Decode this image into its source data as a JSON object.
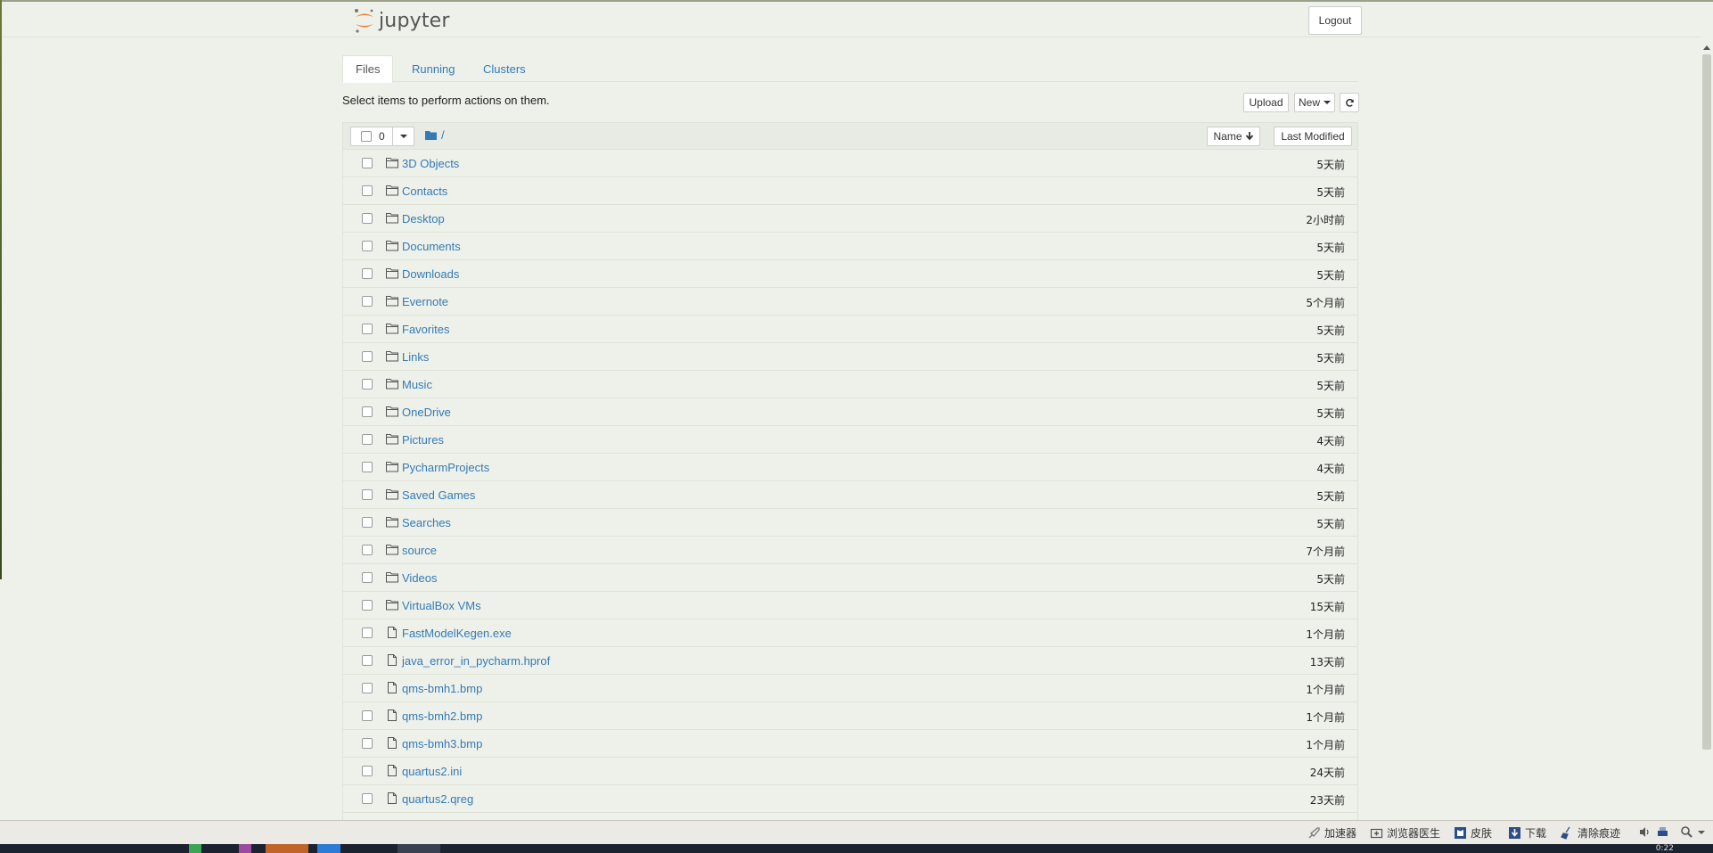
{
  "header": {
    "logo_text": "jupyter",
    "logout_label": "Logout"
  },
  "tabs": [
    {
      "label": "Files",
      "active": true
    },
    {
      "label": "Running",
      "active": false
    },
    {
      "label": "Clusters",
      "active": false
    }
  ],
  "toolbar": {
    "instructions": "Select items to perform actions on them.",
    "upload_label": "Upload",
    "new_label": "New",
    "refresh_icon": "refresh-icon"
  },
  "list_header": {
    "selected_count": "0",
    "breadcrumb": "/",
    "sort_name_label": "Name",
    "sort_modified_label": "Last Modified"
  },
  "items": [
    {
      "name": "3D Objects",
      "type": "folder",
      "modified": "5天前"
    },
    {
      "name": "Contacts",
      "type": "folder",
      "modified": "5天前"
    },
    {
      "name": "Desktop",
      "type": "folder",
      "modified": "2小时前"
    },
    {
      "name": "Documents",
      "type": "folder",
      "modified": "5天前"
    },
    {
      "name": "Downloads",
      "type": "folder",
      "modified": "5天前"
    },
    {
      "name": "Evernote",
      "type": "folder",
      "modified": "5个月前"
    },
    {
      "name": "Favorites",
      "type": "folder",
      "modified": "5天前"
    },
    {
      "name": "Links",
      "type": "folder",
      "modified": "5天前"
    },
    {
      "name": "Music",
      "type": "folder",
      "modified": "5天前"
    },
    {
      "name": "OneDrive",
      "type": "folder",
      "modified": "5天前"
    },
    {
      "name": "Pictures",
      "type": "folder",
      "modified": "4天前"
    },
    {
      "name": "PycharmProjects",
      "type": "folder",
      "modified": "4天前"
    },
    {
      "name": "Saved Games",
      "type": "folder",
      "modified": "5天前"
    },
    {
      "name": "Searches",
      "type": "folder",
      "modified": "5天前"
    },
    {
      "name": "source",
      "type": "folder",
      "modified": "7个月前"
    },
    {
      "name": "Videos",
      "type": "folder",
      "modified": "5天前"
    },
    {
      "name": "VirtualBox VMs",
      "type": "folder",
      "modified": "15天前"
    },
    {
      "name": "FastModelKegen.exe",
      "type": "file",
      "modified": "1个月前"
    },
    {
      "name": "java_error_in_pycharm.hprof",
      "type": "file",
      "modified": "13天前"
    },
    {
      "name": "qms-bmh1.bmp",
      "type": "file",
      "modified": "1个月前"
    },
    {
      "name": "qms-bmh2.bmp",
      "type": "file",
      "modified": "1个月前"
    },
    {
      "name": "qms-bmh3.bmp",
      "type": "file",
      "modified": "1个月前"
    },
    {
      "name": "quartus2.ini",
      "type": "file",
      "modified": "24天前"
    },
    {
      "name": "quartus2.qreg",
      "type": "file",
      "modified": "23天前"
    },
    {
      "name": "",
      "type": "file",
      "modified": ""
    }
  ],
  "statusbar": {
    "accelerator": "加速器",
    "browser_doctor": "浏览器医生",
    "skin": "皮肤",
    "download": "下载",
    "clear_traces": "清除痕迹"
  },
  "taskbar": {
    "clock": "0:22"
  }
}
